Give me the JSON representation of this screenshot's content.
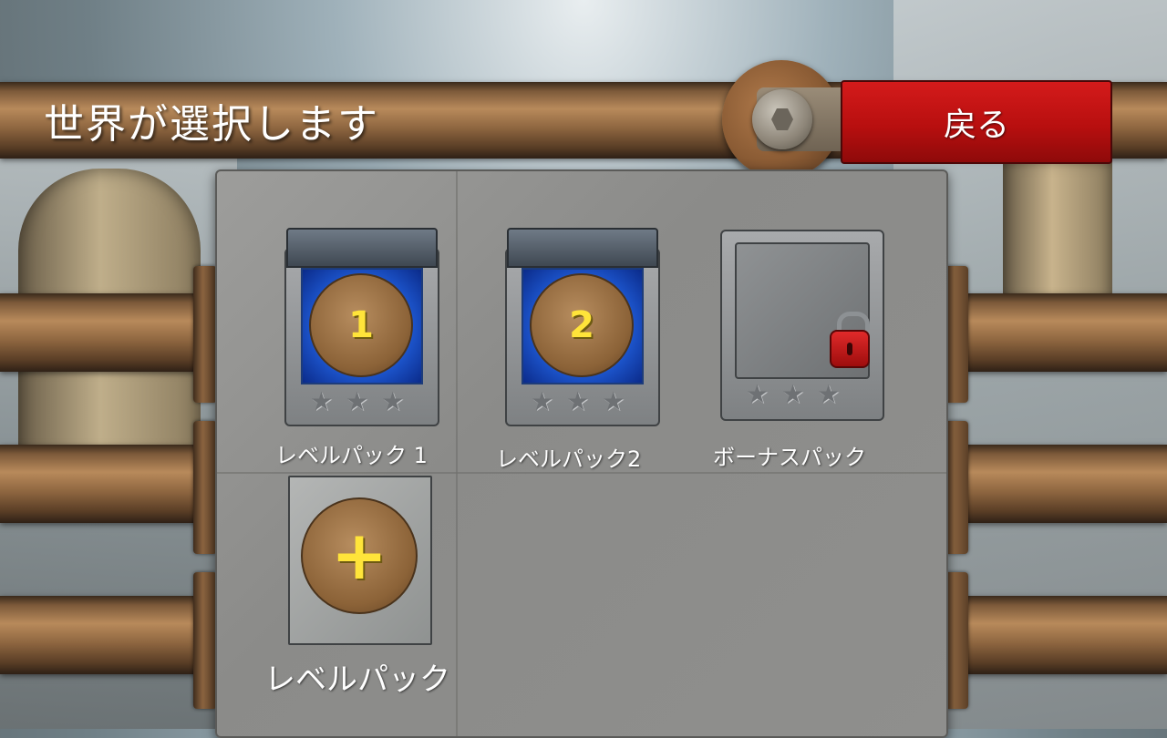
{
  "header": {
    "title": "世界が選択します",
    "back_label": "戻る"
  },
  "packs": [
    {
      "label": "レベルパック 1",
      "number": "1",
      "stars_earned": 0,
      "stars_total": 3,
      "locked": false
    },
    {
      "label": "レベルパック2",
      "number": "2",
      "stars_earned": 0,
      "stars_total": 3,
      "locked": false
    },
    {
      "label": "ボーナスパック",
      "stars_earned": 0,
      "stars_total": 3,
      "locked": true
    },
    {
      "label": "レベルパック",
      "symbol": "+",
      "custom": true
    }
  ],
  "icons": {
    "star": "star-icon",
    "lock": "padlock-icon",
    "valve": "valve-icon"
  },
  "colors": {
    "back_button": "#c41414",
    "number": "#ffe43a",
    "window": "#1f5bd6"
  }
}
